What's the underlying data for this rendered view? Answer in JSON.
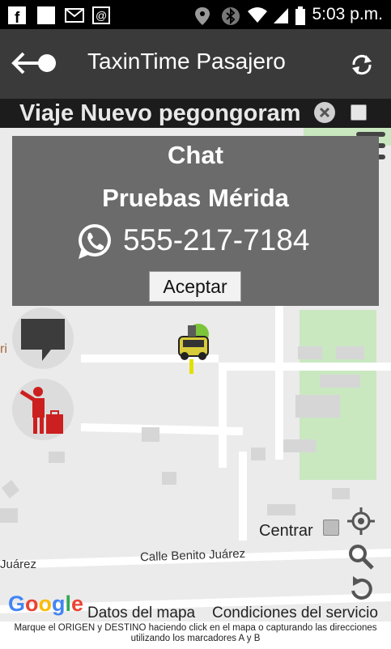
{
  "status_bar": {
    "time": "5:03 p.m."
  },
  "app_bar": {
    "title": "TaxinTime Pasajero"
  },
  "trip_bar": {
    "label": "Viaje Nuevo pegongoram"
  },
  "dialog": {
    "title": "Chat",
    "name": "Pruebas Mérida",
    "phone": "555-217-7184",
    "accept_label": "Aceptar"
  },
  "map": {
    "centrar_label": "Centrar",
    "street_1": "Calle Benito Juárez",
    "street_2": "Juárez",
    "edge_text": "ri"
  },
  "footer": {
    "google": "Google",
    "datos": "Datos del mapa",
    "condiciones": "Condiciones del servicio",
    "instructions": "Marque el ORIGEN y DESTINO haciendo click en el mapa o capturando las direcciones utilizando los marcadores A y B"
  },
  "colors": {
    "accent_red": "#cc1f1f",
    "dialog_bg": "#6b6b6b",
    "whatsapp_green": "#25d366"
  },
  "icons": [
    "facebook-icon",
    "notification-icon",
    "mail-icon",
    "at-icon",
    "location-icon",
    "bluetooth-icon",
    "wifi-icon",
    "signal-icon",
    "battery-icon",
    "back-icon",
    "refresh-icon",
    "close-icon",
    "whatsapp-icon",
    "chat-icon",
    "hail-taxi-icon",
    "taxi-marker-icon",
    "my-location-icon",
    "search-icon",
    "reload-icon",
    "menu-icon"
  ]
}
